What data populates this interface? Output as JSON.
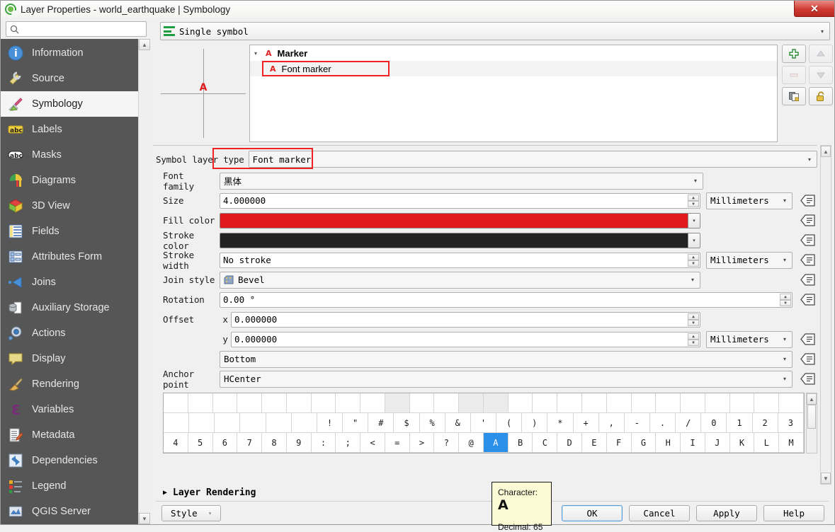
{
  "window": {
    "title": "Layer Properties - world_earthquake | Symbology",
    "close_label": "✕",
    "logo_icon": "qgis-logo-icon"
  },
  "search": {
    "value": "",
    "placeholder": "",
    "icon": "search-icon"
  },
  "sidebar": {
    "items": [
      {
        "label": "Information",
        "icon": "information-icon",
        "selected": false
      },
      {
        "label": "Source",
        "icon": "source-icon",
        "selected": false
      },
      {
        "label": "Symbology",
        "icon": "symbology-brush-icon",
        "selected": true
      },
      {
        "label": "Labels",
        "icon": "labels-abc-icon",
        "selected": false
      },
      {
        "label": "Masks",
        "icon": "masks-abc-icon",
        "selected": false
      },
      {
        "label": "Diagrams",
        "icon": "diagrams-chart-icon",
        "selected": false
      },
      {
        "label": "3D View",
        "icon": "3d-view-cube-icon",
        "selected": false
      },
      {
        "label": "Fields",
        "icon": "fields-table-icon",
        "selected": false
      },
      {
        "label": "Attributes Form",
        "icon": "attributes-form-icon",
        "selected": false
      },
      {
        "label": "Joins",
        "icon": "joins-icon",
        "selected": false
      },
      {
        "label": "Auxiliary Storage",
        "icon": "auxiliary-storage-icon",
        "selected": false
      },
      {
        "label": "Actions",
        "icon": "actions-gear-icon",
        "selected": false
      },
      {
        "label": "Display",
        "icon": "display-balloon-icon",
        "selected": false
      },
      {
        "label": "Rendering",
        "icon": "rendering-brush-icon",
        "selected": false
      },
      {
        "label": "Variables",
        "icon": "variables-epsilon-icon",
        "selected": false
      },
      {
        "label": "Metadata",
        "icon": "metadata-pencil-icon",
        "selected": false
      },
      {
        "label": "Dependencies",
        "icon": "dependencies-arrows-icon",
        "selected": false
      },
      {
        "label": "Legend",
        "icon": "legend-icon",
        "selected": false
      },
      {
        "label": "QGIS Server",
        "icon": "qgis-server-icon",
        "selected": false
      }
    ],
    "scroll_up": "▲",
    "scroll_down": "▼"
  },
  "renderer": {
    "label": "Single symbol",
    "icon": "single-symbol-icon",
    "caret": "▾"
  },
  "preview": {
    "glyph": "A",
    "glyph_color": "#e02020"
  },
  "layer_tree": {
    "root": {
      "label": "Marker",
      "twisty": "▾",
      "icon": "marker-a-icon"
    },
    "child": {
      "label": "Font marker",
      "icon": "marker-a-icon",
      "highlighted": true
    }
  },
  "tree_buttons": [
    {
      "name": "add-symbol-layer-button",
      "icon": "plus-icon",
      "enabled": true
    },
    {
      "name": "move-up-button",
      "icon": "arrow-up-icon",
      "enabled": false
    },
    {
      "name": "remove-symbol-layer-button",
      "icon": "minus-icon",
      "enabled": false
    },
    {
      "name": "move-down-button",
      "icon": "arrow-down-icon",
      "enabled": false
    },
    {
      "name": "duplicate-symbol-layer-button",
      "icon": "duplicate-icon",
      "enabled": true
    },
    {
      "name": "lock-layer-button",
      "icon": "unlock-padlock-icon",
      "enabled": true
    }
  ],
  "properties": {
    "symbol_layer_type": {
      "label": "Symbol layer type",
      "value": "Font marker",
      "highlighted": true
    },
    "font_family": {
      "label": "Font family",
      "value": "黑体"
    },
    "size": {
      "label": "Size",
      "value": "4.000000",
      "unit": "Millimeters"
    },
    "fill_color": {
      "label": "Fill color",
      "value": "#e11b1b"
    },
    "stroke_color": {
      "label": "Stroke color",
      "value": "#232323"
    },
    "stroke_width": {
      "label": "Stroke width",
      "value": "No stroke",
      "unit": "Millimeters"
    },
    "join_style": {
      "label": "Join style",
      "value": "Bevel",
      "icon": "bevel-join-icon"
    },
    "rotation": {
      "label": "Rotation",
      "value": "0.00 °"
    },
    "offset": {
      "label": "Offset",
      "x_label": "x",
      "x_value": "0.000000",
      "y_label": "y",
      "y_value": "0.000000",
      "unit": "Millimeters"
    },
    "anchor_point": {
      "label": "Anchor point",
      "vertical": "Bottom",
      "horizontal": "HCenter"
    }
  },
  "data_defined_override_icon": "data-defined-override-icon",
  "char_grid": {
    "rows": [
      [
        "",
        "",
        "",
        "",
        "",
        "",
        "",
        "",
        "",
        "",
        "",
        "",
        "",
        "",
        "",
        "",
        "",
        "",
        "",
        "",
        "",
        "",
        "",
        "",
        "",
        ""
      ],
      [
        "",
        "",
        "",
        "",
        "",
        "",
        "!",
        "\"",
        "#",
        "$",
        "%",
        "&",
        "'",
        "(",
        ")",
        "*",
        "+",
        ",",
        "-",
        ".",
        "/",
        "0",
        "1",
        "2",
        "3"
      ],
      [
        "4",
        "5",
        "6",
        "7",
        "8",
        "9",
        ":",
        ";",
        "<",
        "=",
        ">",
        "?",
        "@",
        "A",
        "B",
        "C",
        "D",
        "E",
        "F",
        "G",
        "H",
        "I",
        "J",
        "K",
        "L",
        "M"
      ]
    ],
    "shaded_cells": [
      [
        0,
        9
      ],
      [
        0,
        12
      ],
      [
        0,
        13
      ]
    ],
    "selected": {
      "row": 2,
      "col": 13,
      "char": "A"
    }
  },
  "tooltip": {
    "character_label": "Character:",
    "character_value": "A",
    "decimal_label": "Decimal:",
    "decimal_value": "65"
  },
  "footer": {
    "layer_rendering": {
      "label": "Layer Rendering",
      "twisty": "▶"
    },
    "style_button": {
      "label": "Style",
      "caret": "▾"
    },
    "buttons": [
      {
        "label": "OK",
        "primary": true
      },
      {
        "label": "Cancel",
        "primary": false
      },
      {
        "label": "Apply",
        "primary": false
      },
      {
        "label": "Help",
        "primary": false
      }
    ]
  },
  "colors": {
    "accent": "#2a90e8",
    "highlight_box": "#ee2222",
    "sidebar_bg": "#565656"
  }
}
